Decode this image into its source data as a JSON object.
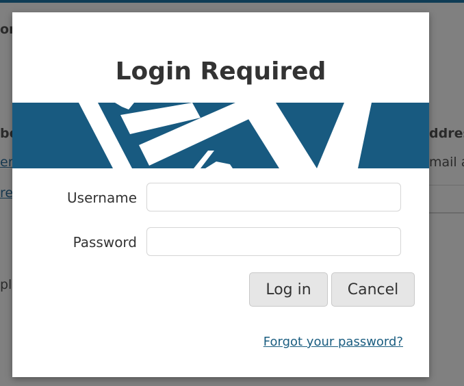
{
  "background": {
    "fragments": {
      "top_left": "or",
      "left_1": "be",
      "left_2": "er",
      "left_3": "re",
      "left_4": "pl",
      "right_header": "ddres",
      "right_sub": "mail a"
    }
  },
  "dialog": {
    "title": "Login Required",
    "banner_color": "#185a80",
    "username": {
      "label": "Username",
      "value": "",
      "placeholder": ""
    },
    "password": {
      "label": "Password",
      "value": "",
      "placeholder": ""
    },
    "buttons": {
      "login": "Log in",
      "cancel": "Cancel"
    },
    "forgot_password": "Forgot your password?"
  }
}
